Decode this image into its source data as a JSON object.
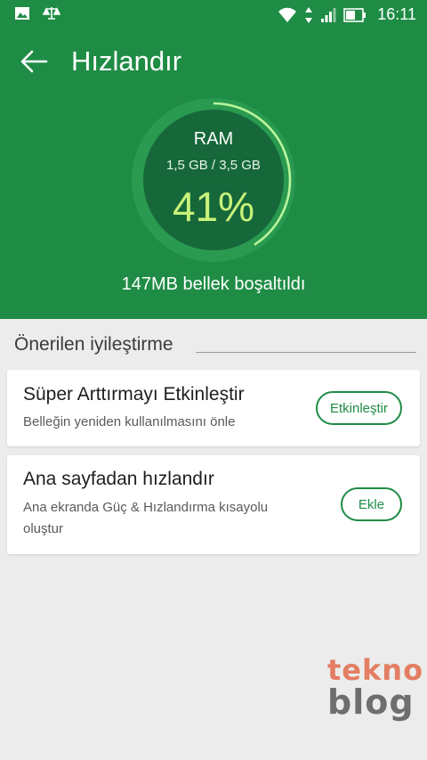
{
  "status_bar": {
    "time": "16:11",
    "icons": [
      "image-icon",
      "scales-icon",
      "wifi-icon",
      "data-arrows-icon",
      "signal-icon",
      "battery-icon"
    ]
  },
  "header": {
    "title": "Hızlandır",
    "back_icon": "arrow-left-icon"
  },
  "ram": {
    "label": "RAM",
    "usage": "1,5 GB / 3,5 GB",
    "percent_text": "41%",
    "percent": 41
  },
  "freed_text": "147MB bellek boşaltıldı",
  "recommendations": {
    "title": "Önerilen iyileştirme",
    "items": [
      {
        "title": "Süper Arttırmayı Etkinleştir",
        "description": "Belleğin yeniden kullanılmasını önle",
        "button": "Etkinleştir"
      },
      {
        "title": "Ana sayfadan hızlandır",
        "description": "Ana ekranda Güç & Hızlandırma kısayolu oluştur",
        "button": "Ekle"
      }
    ]
  },
  "watermark": {
    "line1": "tekno",
    "line2": "blog"
  },
  "colors": {
    "header_green": "#1f8c45",
    "ring_track": "#2a9a50",
    "ring_inner": "#16683a",
    "ring_progress": "#b8f59a",
    "percent_text": "#c9f27a",
    "background": "#ececec"
  }
}
